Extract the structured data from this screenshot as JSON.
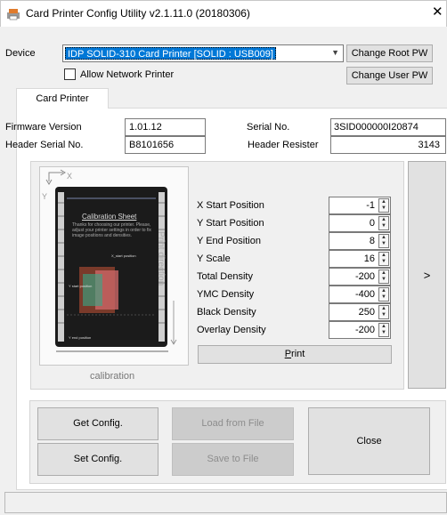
{
  "window": {
    "title": "Card Printer Config Utility v2.1.11.0 (20180306)",
    "close_glyph": "✕"
  },
  "device": {
    "label": "Device",
    "selected": "IDP SOLID-310 Card Printer  [SOLID : USB009]",
    "change_root_pw": "Change Root PW",
    "change_user_pw": "Change User PW",
    "allow_network_label": "Allow Network Printer",
    "allow_network_checked": false
  },
  "tabs": [
    {
      "label": "Card Printer",
      "active": true
    }
  ],
  "info": {
    "firmware_label": "Firmware Version",
    "firmware_value": "1.01.12",
    "serial_label": "Serial No.",
    "serial_value": "3SID000000I20874",
    "header_serial_label": "Header Serial No.",
    "header_serial_value": "B8101656",
    "header_resister_label": "Header Resister",
    "header_resister_value": "3143"
  },
  "preview": {
    "caption": "calibration",
    "x_axis": "X",
    "y_axis": "Y",
    "print_direction": "Print direction",
    "sheet_title": "Calibration Sheet",
    "sheet_text": "Thanks for choosing our printer. Please, adjust your printer settings in order to fix image positions and densities.",
    "x_start": "X_start position",
    "y_start": "Y start position",
    "y_end": "Y end position"
  },
  "params": [
    {
      "label": "X Start Position",
      "value": "-1"
    },
    {
      "label": "Y Start Position",
      "value": "0"
    },
    {
      "label": "Y End Position",
      "value": "8"
    },
    {
      "label": "Y Scale",
      "value": "16"
    },
    {
      "label": "Total Density",
      "value": "-200"
    },
    {
      "label": "YMC Density",
      "value": "-400"
    },
    {
      "label": "Black Density",
      "value": "250"
    },
    {
      "label": "Overlay Density",
      "value": "-200"
    }
  ],
  "print_button": {
    "label": "Print",
    "underline_char": "P"
  },
  "arrow_button": ">",
  "actions": {
    "get_config": "Get Config.",
    "set_config": "Set Config.",
    "load_from_file": "Load from File",
    "save_to_file": "Save to File",
    "close": "Close"
  },
  "icons": {
    "app": "printer-app-icon",
    "dropdown": "chevron-down-icon",
    "spinner": "spin-arrows-icon"
  },
  "colors": {
    "selection": "#0078d7",
    "button": "#e1e1e1",
    "disabled_text": "#8d8d8d"
  }
}
